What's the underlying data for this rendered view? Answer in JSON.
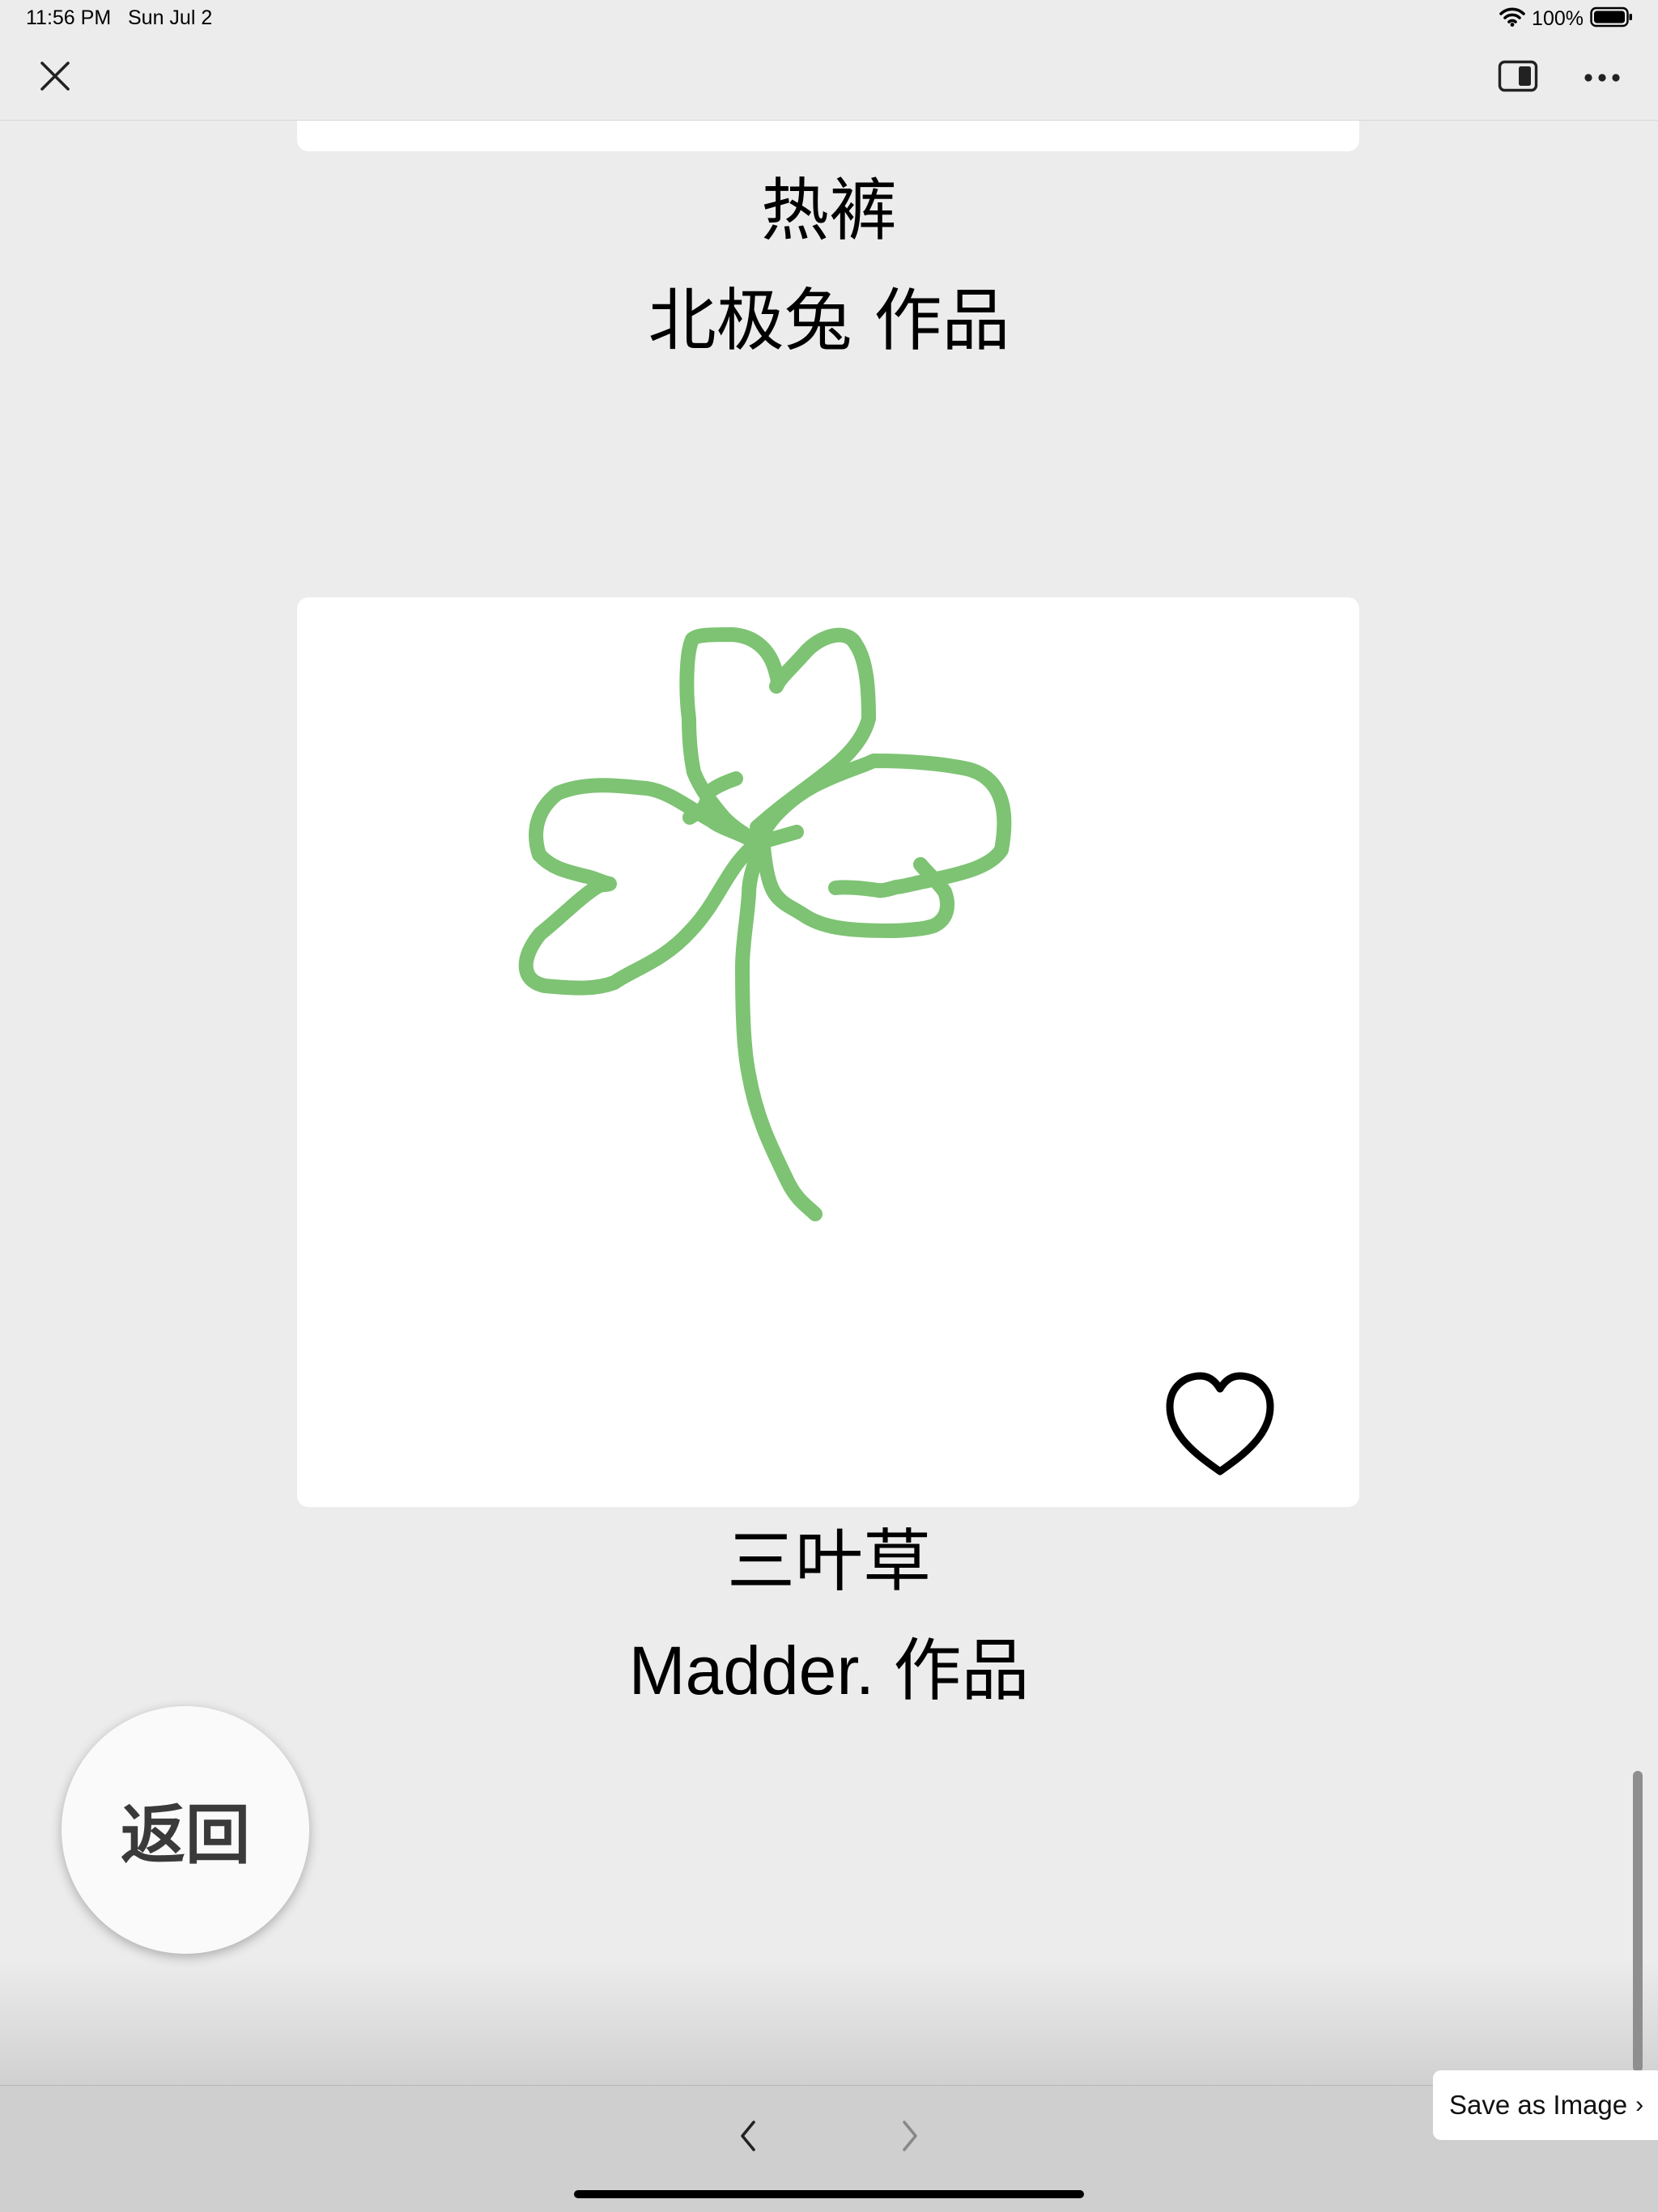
{
  "status_bar": {
    "time": "11:56 PM",
    "date": "Sun Jul 2",
    "battery": "100%",
    "icons": [
      "wifi-icon",
      "battery-icon"
    ]
  },
  "nav": {
    "close_icon": "close-icon",
    "split_view_icon": "split-view-icon",
    "more_icon": "more-icon"
  },
  "artworks": [
    {
      "title": "热裤",
      "author": "北极兔 作品"
    },
    {
      "title": "三叶草",
      "author": "Madder. 作品",
      "drawing": "clover-drawing",
      "stroke_color": "#7dc373"
    }
  ],
  "back_button": {
    "label": "返回"
  },
  "save_as_image": {
    "label": "Save as Image",
    "chevron": "›"
  },
  "toolbar": {
    "back_icon": "chevron-left-icon",
    "forward_icon": "chevron-right-icon"
  }
}
